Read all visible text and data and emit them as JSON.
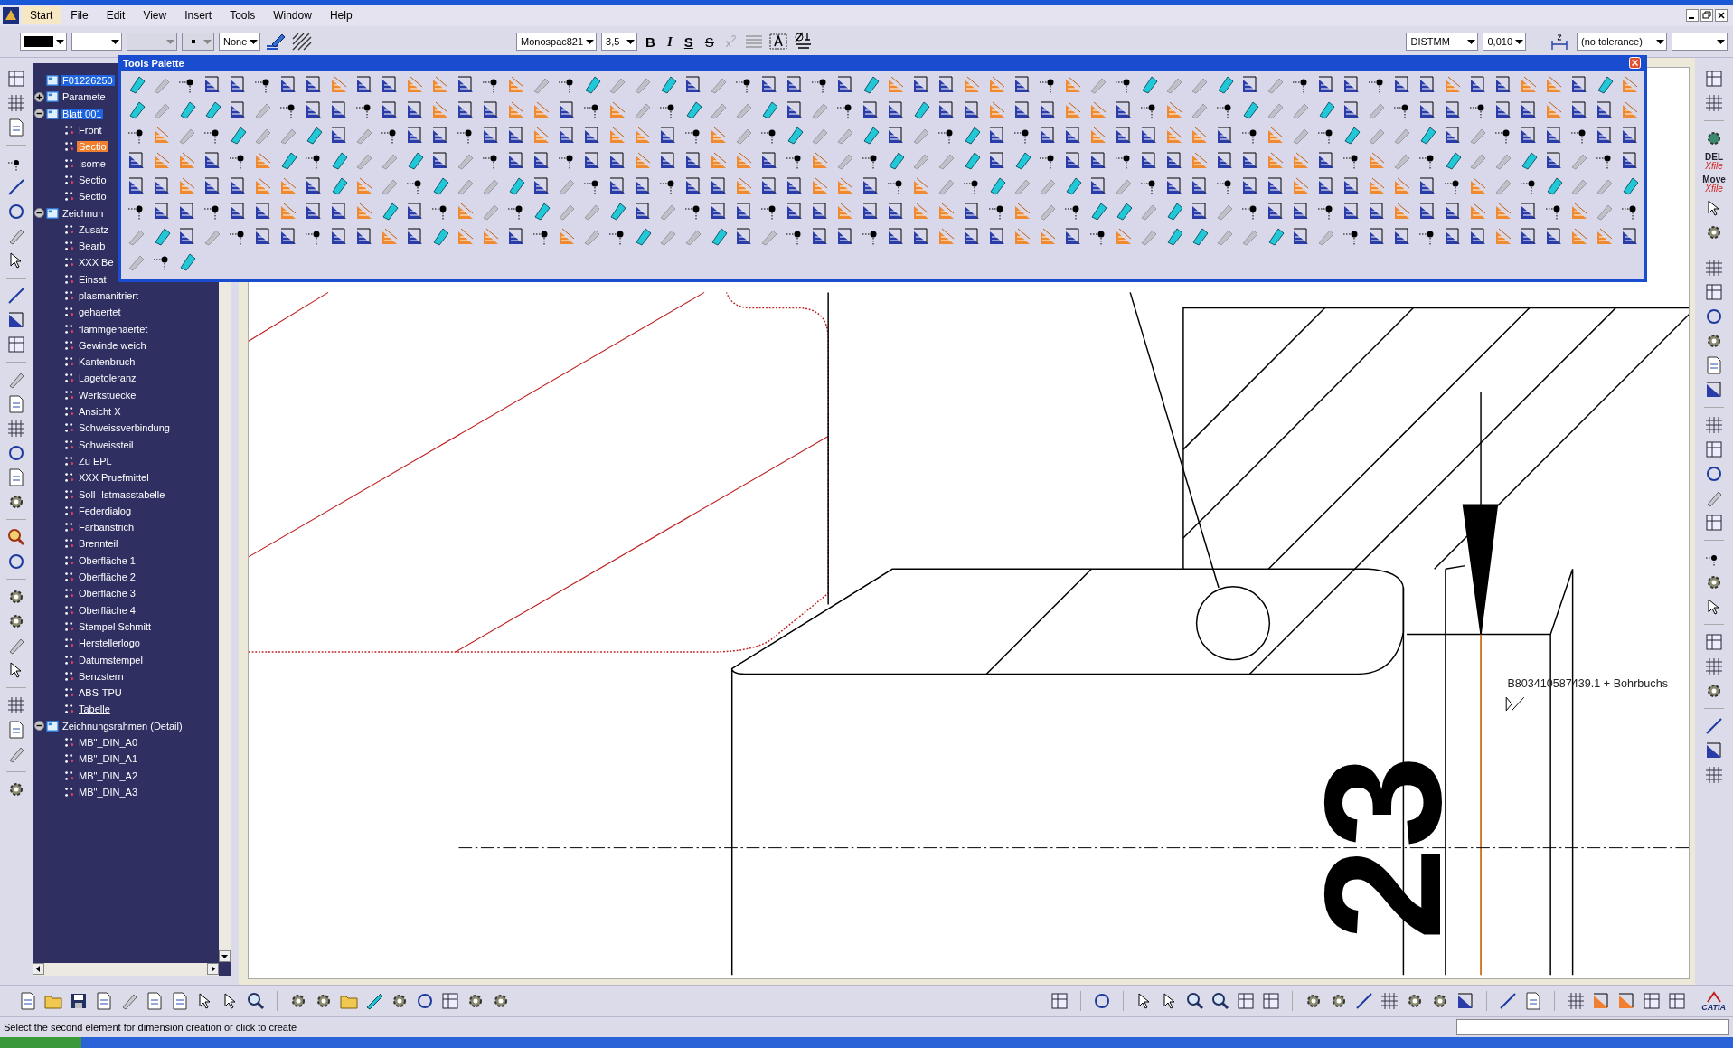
{
  "menu_bar": {
    "items": [
      {
        "label": "Start",
        "selected": true
      },
      {
        "label": "File",
        "selected": false
      },
      {
        "label": "Edit",
        "selected": false
      },
      {
        "label": "View",
        "selected": false
      },
      {
        "label": "Insert",
        "selected": false
      },
      {
        "label": "Tools",
        "selected": false
      },
      {
        "label": "Window",
        "selected": false
      },
      {
        "label": "Help",
        "selected": false
      }
    ]
  },
  "toolbar": {
    "pattern": "None",
    "font": "Monospac821",
    "font_size": "3,5",
    "format_buttons": [
      {
        "label": "B",
        "kind": "bold",
        "disabled": false
      },
      {
        "label": "I",
        "kind": "italic",
        "disabled": false
      },
      {
        "label": "S",
        "kind": "underline",
        "disabled": false
      },
      {
        "label": "S",
        "kind": "strike",
        "disabled": false
      },
      {
        "label": "x$^{2}$",
        "kind": "superscript",
        "disabled": true
      }
    ],
    "dimension_style": "DISTMM",
    "precision": "0,010",
    "tolerance": "(no tolerance)"
  },
  "tools_palette": {
    "title": "Tools Palette"
  },
  "tree": [
    {
      "label": "F01226250",
      "active": true,
      "selected": false,
      "underlined": false
    },
    {
      "label": "Paramete",
      "active": false,
      "selected": false,
      "underlined": false,
      "expanded": false
    },
    {
      "label": "Blatt 001",
      "active": true,
      "selected": false,
      "underlined": false,
      "expanded": true,
      "children": [
        {
          "label": "Front",
          "active": false,
          "selected": false,
          "underlined": false
        },
        {
          "label": "Sectio",
          "active": false,
          "selected": true,
          "underlined": false
        },
        {
          "label": "Isome",
          "active": false,
          "selected": false,
          "underlined": false
        },
        {
          "label": "Sectio",
          "active": false,
          "selected": false,
          "underlined": false
        },
        {
          "label": "Sectio",
          "active": false,
          "selected": false,
          "underlined": false
        }
      ]
    },
    {
      "label": "Zeichnun",
      "active": false,
      "selected": false,
      "underlined": false,
      "expanded": true,
      "children": [
        {
          "label": "Zusatz",
          "active": false,
          "selected": false,
          "underlined": false
        },
        {
          "label": "Bearb",
          "active": false,
          "selected": false,
          "underlined": false
        },
        {
          "label": "XXX Be",
          "active": false,
          "selected": false,
          "underlined": false
        },
        {
          "label": "Einsat",
          "active": false,
          "selected": false,
          "underlined": false
        },
        {
          "label": "plasmanitriert",
          "active": false,
          "selected": false,
          "underlined": false
        },
        {
          "label": "gehaertet",
          "active": false,
          "selected": false,
          "underlined": false
        },
        {
          "label": "flammgehaertet",
          "active": false,
          "selected": false,
          "underlined": false
        },
        {
          "label": "Gewinde weich",
          "active": false,
          "selected": false,
          "underlined": false
        },
        {
          "label": "Kantenbruch",
          "active": false,
          "selected": false,
          "underlined": false
        },
        {
          "label": "Lagetoleranz",
          "active": false,
          "selected": false,
          "underlined": false
        },
        {
          "label": "Werkstuecke",
          "active": false,
          "selected": false,
          "underlined": false
        },
        {
          "label": "Ansicht X",
          "active": false,
          "selected": false,
          "underlined": false
        },
        {
          "label": "Schweissverbindung",
          "active": false,
          "selected": false,
          "underlined": false
        },
        {
          "label": "Schweissteil",
          "active": false,
          "selected": false,
          "underlined": false
        },
        {
          "label": "Zu EPL",
          "active": false,
          "selected": false,
          "underlined": false
        },
        {
          "label": "XXX Pruefmittel",
          "active": false,
          "selected": false,
          "underlined": false
        },
        {
          "label": "Soll- Istmasstabelle",
          "active": false,
          "selected": false,
          "underlined": false
        },
        {
          "label": "Federdialog",
          "active": false,
          "selected": false,
          "underlined": false
        },
        {
          "label": "Farbanstrich",
          "active": false,
          "selected": false,
          "underlined": false
        },
        {
          "label": "Brennteil",
          "active": false,
          "selected": false,
          "underlined": false
        },
        {
          "label": "Oberfläche 1",
          "active": false,
          "selected": false,
          "underlined": false
        },
        {
          "label": "Oberfläche 2",
          "active": false,
          "selected": false,
          "underlined": false
        },
        {
          "label": "Oberfläche 3",
          "active": false,
          "selected": false,
          "underlined": false
        },
        {
          "label": "Oberfläche 4",
          "active": false,
          "selected": false,
          "underlined": false
        },
        {
          "label": "Stempel Schmitt",
          "active": false,
          "selected": false,
          "underlined": false
        },
        {
          "label": "Herstellerlogo",
          "active": false,
          "selected": false,
          "underlined": false
        },
        {
          "label": "Datumstempel",
          "active": false,
          "selected": false,
          "underlined": false
        },
        {
          "label": "Benzstern",
          "active": false,
          "selected": false,
          "underlined": false
        },
        {
          "label": "ABS-TPU",
          "active": false,
          "selected": false,
          "underlined": false
        },
        {
          "label": "Tabelle",
          "active": false,
          "selected": false,
          "underlined": true
        }
      ]
    },
    {
      "label": "Zeichnungsrahmen (Detail)",
      "active": false,
      "selected": false,
      "underlined": false,
      "expanded": true,
      "children": [
        {
          "label": "MB\"_DIN_A0",
          "active": false,
          "selected": false,
          "underlined": false
        },
        {
          "label": "MB\"_DIN_A1",
          "active": false,
          "selected": false,
          "underlined": false
        },
        {
          "label": "MB\"_DIN_A2",
          "active": false,
          "selected": false,
          "underlined": false
        },
        {
          "label": "MB\"_DIN_A3",
          "active": false,
          "selected": false,
          "underlined": false
        }
      ]
    }
  ],
  "drawing": {
    "dimension_value": "23",
    "annotation": "B803410587439.1 + Bohrbuchs"
  },
  "right_toolbar": {
    "labels": [
      {
        "title": "DEL",
        "subtitle": "Xfile"
      },
      {
        "title": "Move",
        "subtitle": "Xfile"
      }
    ]
  },
  "brand": "CATIA",
  "status_bar": {
    "message": "Select the second element for dimension creation or click to create"
  }
}
